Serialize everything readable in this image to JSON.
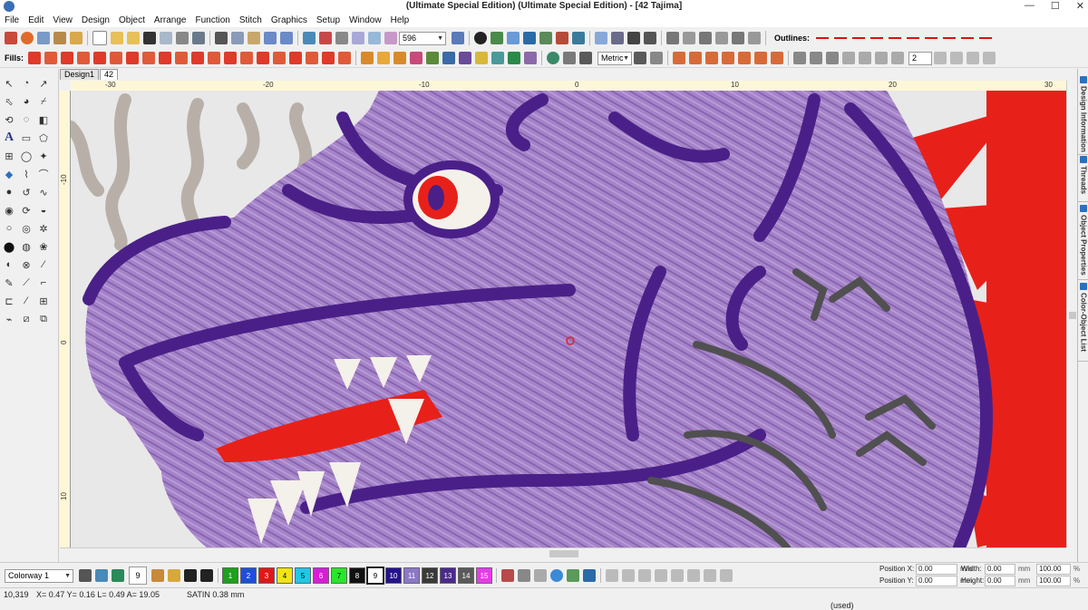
{
  "titlebar": {
    "title": "(Ultimate Special Edition) (Ultimate Special Edition) - [42      Tajima]",
    "minimize": "—",
    "maximize": "☐",
    "close": "✕"
  },
  "menu": [
    "File",
    "Edit",
    "View",
    "Design",
    "Object",
    "Arrange",
    "Function",
    "Stitch",
    "Graphics",
    "Setup",
    "Window",
    "Help"
  ],
  "toolbar1": {
    "density_value": "596",
    "outlines_label": "Outlines:"
  },
  "toolbar2": {
    "fills_label": "Fills:",
    "units_value": "Metric",
    "spacing_value": "2"
  },
  "tabs": [
    "Design1",
    "42"
  ],
  "ruler_h_labels": [
    "-30",
    "-20",
    "-10",
    "0",
    "10",
    "20",
    "30"
  ],
  "ruler_v_labels": [
    "-10",
    "0",
    "10"
  ],
  "side_tabs": [
    "Design Information",
    "Threads",
    "Object Properties",
    "Color-Object List"
  ],
  "colorway": {
    "label": "Colorway 1",
    "current_number": "9",
    "swatches": [
      {
        "n": "1",
        "color": "#1ea01e"
      },
      {
        "n": "2",
        "color": "#1f4fd8"
      },
      {
        "n": "3",
        "color": "#e01818"
      },
      {
        "n": "4",
        "color": "#f2e414"
      },
      {
        "n": "5",
        "color": "#1ec8e6"
      },
      {
        "n": "6",
        "color": "#d61ed6"
      },
      {
        "n": "7",
        "color": "#28e628"
      },
      {
        "n": "8",
        "color": "#111111"
      },
      {
        "n": "9",
        "color": "#ffffff"
      },
      {
        "n": "10",
        "color": "#24128c"
      },
      {
        "n": "11",
        "color": "#8c78c8"
      },
      {
        "n": "12",
        "color": "#3a3a3a"
      },
      {
        "n": "13",
        "color": "#4a2a8a"
      },
      {
        "n": "14",
        "color": "#5a5a5a"
      },
      {
        "n": "15",
        "color": "#e63ce6"
      }
    ]
  },
  "position": {
    "x_label": "Position X:",
    "y_label": "Position Y:",
    "x_value": "0.00",
    "y_value": "0.00",
    "unit": "mm",
    "width_label": "Width:",
    "height_label": "Height:",
    "width_value": "0.00",
    "height_value": "0.00",
    "scale_w": "100.00",
    "scale_h": "100.00",
    "percent": "%"
  },
  "status": {
    "stitch_count": "10,319",
    "coords": "X= 0.47 Y= 0.16 L= 0.49 A= 19.05",
    "stitch_type": "SATIN  0.38 mm",
    "used": "(used)"
  },
  "colors": {
    "bg_canvas": "#e8e8e8",
    "dragon_fill": "#a07cc4",
    "dragon_outline": "#4a2088",
    "tongue_red": "#e8201a",
    "teeth": "#f4f0ea",
    "horns": "#b8b0a8",
    "scales": "#505050",
    "ruler": "#fdf7d8"
  }
}
